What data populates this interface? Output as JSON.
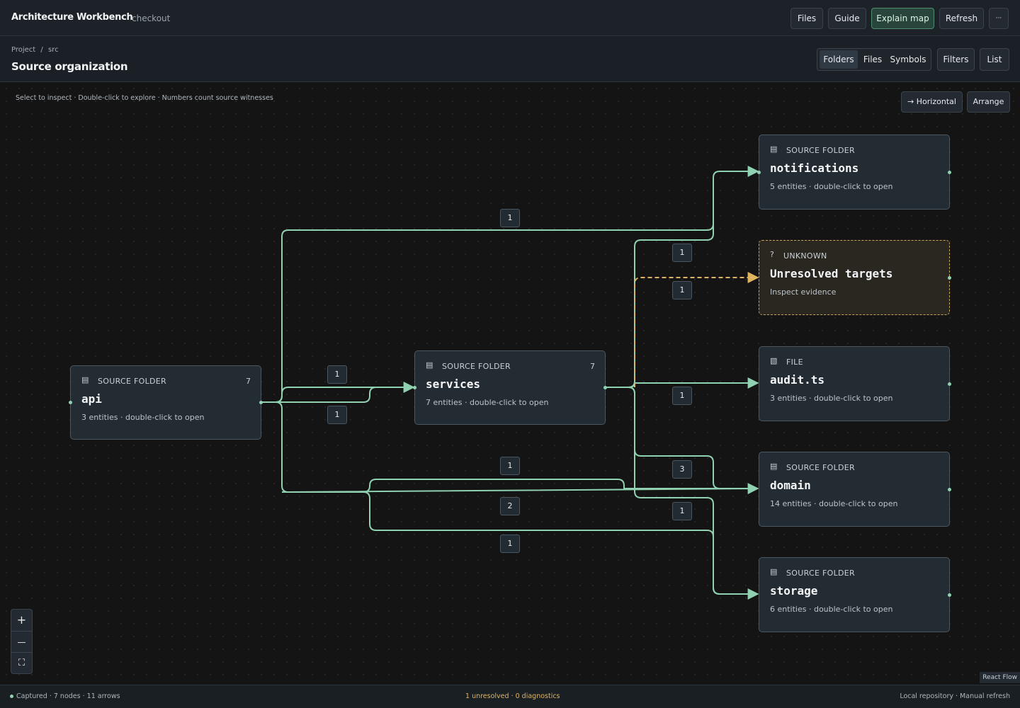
{
  "header": {
    "app_title": "Architecture Workbench",
    "context": "checkout",
    "buttons": {
      "files": "Files",
      "guide": "Guide",
      "explain": "Explain map",
      "refresh": "Refresh",
      "more": "···"
    }
  },
  "subheader": {
    "breadcrumb": [
      "Project",
      "/",
      "src"
    ],
    "title": "Source organization",
    "view_modes": [
      "Folders",
      "Files",
      "Symbols"
    ],
    "active_view": "Folders",
    "filters_label": "Filters",
    "list_label": "List"
  },
  "canvas": {
    "hint": "Select to inspect · Double-click to explore · Numbers count source witnesses",
    "orientation_label": "→ Horizontal",
    "arrange_label": "Arrange",
    "nodes": {
      "api": {
        "kind": "SOURCE FOLDER",
        "name": "api",
        "count": "7",
        "subtitle": "3 entities · double-click to open",
        "icon": "folder-icon"
      },
      "services": {
        "kind": "SOURCE FOLDER",
        "name": "services",
        "count": "7",
        "subtitle": "7 entities · double-click to open",
        "icon": "folder-icon"
      },
      "notifications": {
        "kind": "SOURCE FOLDER",
        "name": "notifications",
        "subtitle": "5 entities · double-click to open",
        "icon": "folder-icon"
      },
      "unresolved": {
        "kind": "UNKNOWN",
        "name": "Unresolved targets",
        "subtitle": "Inspect evidence",
        "icon": "question-icon"
      },
      "audit": {
        "kind": "FILE",
        "name": "audit.ts",
        "subtitle": "3 entities · double-click to open",
        "icon": "file-icon"
      },
      "domain": {
        "kind": "SOURCE FOLDER",
        "name": "domain",
        "subtitle": "14 entities · double-click to open",
        "icon": "folder-icon"
      },
      "storage": {
        "kind": "SOURCE FOLDER",
        "name": "storage",
        "subtitle": "6 entities · double-click to open",
        "icon": "folder-icon"
      }
    },
    "edge_labels": {
      "api_notifications": "1",
      "api_services_a": "1",
      "api_services_b": "1",
      "api_domain": "1",
      "api_domain_b": "2",
      "api_storage": "1",
      "services_notifications": "1",
      "services_unresolved": "1",
      "services_audit": "1",
      "services_domain": "3",
      "services_storage": "1"
    },
    "zoom": {
      "in": "+",
      "out": "—",
      "fit": "⛶"
    },
    "attribution": "React Flow"
  },
  "status": {
    "left": "Captured · 7 nodes · 11 arrows",
    "middle": "1 unresolved · 0 diagnostics",
    "right": "Local repository · Manual refresh"
  },
  "colors": {
    "edge": "#8fd1b0",
    "unresolved_edge": "#e0b45f",
    "accent": "#4f8c6f"
  }
}
